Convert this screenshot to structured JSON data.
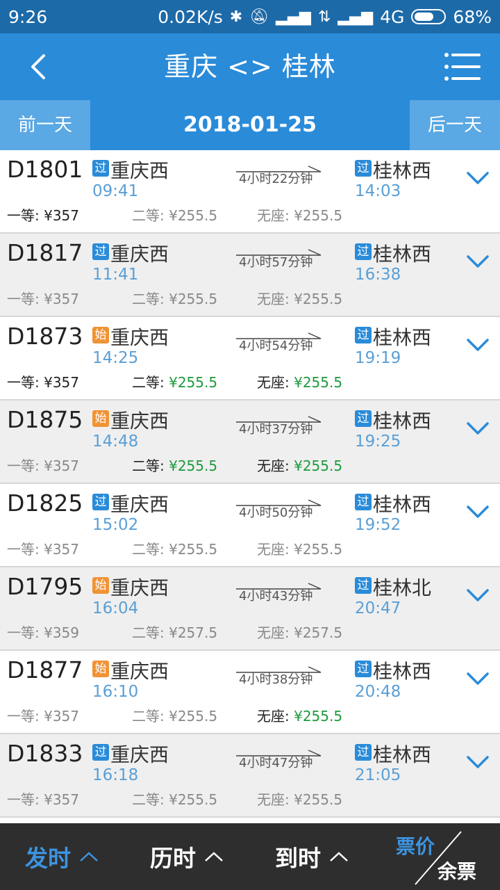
{
  "statusbar": {
    "time": "9:26",
    "speed": "0.02K/s",
    "network": "4G",
    "battery": "68%",
    "battery_level": 0.68
  },
  "header": {
    "title": "重庆 <> 桂林"
  },
  "datebar": {
    "prev_label": "前一天",
    "date": "2018-01-25",
    "next_label": "后一天"
  },
  "trains": [
    {
      "no": "D1801",
      "dep_badge": "过",
      "dep_badge_type": "pass",
      "dep_station": "重庆西",
      "dep_time": "09:41",
      "duration": "4小时22分钟",
      "arr_badge": "过",
      "arr_badge_type": "pass",
      "arr_station": "桂林西",
      "arr_time": "14:03",
      "first_label": "一等:",
      "first_price": "¥357",
      "first_avail": true,
      "second_label": "二等:",
      "second_price": "¥255.5",
      "second_avail": false,
      "noseat_label": "无座:",
      "noseat_price": "¥255.5",
      "noseat_avail": false
    },
    {
      "no": "D1817",
      "dep_badge": "过",
      "dep_badge_type": "pass",
      "dep_station": "重庆西",
      "dep_time": "11:41",
      "duration": "4小时57分钟",
      "arr_badge": "过",
      "arr_badge_type": "pass",
      "arr_station": "桂林西",
      "arr_time": "16:38",
      "first_label": "一等:",
      "first_price": "¥357",
      "first_avail": false,
      "second_label": "二等:",
      "second_price": "¥255.5",
      "second_avail": false,
      "noseat_label": "无座:",
      "noseat_price": "¥255.5",
      "noseat_avail": false
    },
    {
      "no": "D1873",
      "dep_badge": "始",
      "dep_badge_type": "start",
      "dep_station": "重庆西",
      "dep_time": "14:25",
      "duration": "4小时54分钟",
      "arr_badge": "过",
      "arr_badge_type": "pass",
      "arr_station": "桂林西",
      "arr_time": "19:19",
      "first_label": "一等:",
      "first_price": "¥357",
      "first_avail": true,
      "second_label": "二等:",
      "second_price": "¥255.5",
      "second_avail": true,
      "second_green": true,
      "noseat_label": "无座:",
      "noseat_price": "¥255.5",
      "noseat_avail": true,
      "noseat_green": true
    },
    {
      "no": "D1875",
      "dep_badge": "始",
      "dep_badge_type": "start",
      "dep_station": "重庆西",
      "dep_time": "14:48",
      "duration": "4小时37分钟",
      "arr_badge": "过",
      "arr_badge_type": "pass",
      "arr_station": "桂林西",
      "arr_time": "19:25",
      "first_label": "一等:",
      "first_price": "¥357",
      "first_avail": false,
      "second_label": "二等:",
      "second_price": "¥255.5",
      "second_avail": true,
      "second_green": true,
      "noseat_label": "无座:",
      "noseat_price": "¥255.5",
      "noseat_avail": true,
      "noseat_green": true
    },
    {
      "no": "D1825",
      "dep_badge": "过",
      "dep_badge_type": "pass",
      "dep_station": "重庆西",
      "dep_time": "15:02",
      "duration": "4小时50分钟",
      "arr_badge": "过",
      "arr_badge_type": "pass",
      "arr_station": "桂林西",
      "arr_time": "19:52",
      "first_label": "一等:",
      "first_price": "¥357",
      "first_avail": false,
      "second_label": "二等:",
      "second_price": "¥255.5",
      "second_avail": false,
      "noseat_label": "无座:",
      "noseat_price": "¥255.5",
      "noseat_avail": false
    },
    {
      "no": "D1795",
      "dep_badge": "始",
      "dep_badge_type": "start",
      "dep_station": "重庆西",
      "dep_time": "16:04",
      "duration": "4小时43分钟",
      "arr_badge": "过",
      "arr_badge_type": "pass",
      "arr_station": "桂林北",
      "arr_time": "20:47",
      "first_label": "一等:",
      "first_price": "¥359",
      "first_avail": false,
      "second_label": "二等:",
      "second_price": "¥257.5",
      "second_avail": false,
      "noseat_label": "无座:",
      "noseat_price": "¥257.5",
      "noseat_avail": false
    },
    {
      "no": "D1877",
      "dep_badge": "始",
      "dep_badge_type": "start",
      "dep_station": "重庆西",
      "dep_time": "16:10",
      "duration": "4小时38分钟",
      "arr_badge": "过",
      "arr_badge_type": "pass",
      "arr_station": "桂林西",
      "arr_time": "20:48",
      "first_label": "一等:",
      "first_price": "¥357",
      "first_avail": false,
      "second_label": "二等:",
      "second_price": "¥255.5",
      "second_avail": false,
      "noseat_label": "无座:",
      "noseat_price": "¥255.5",
      "noseat_avail": true,
      "noseat_green": true
    },
    {
      "no": "D1833",
      "dep_badge": "过",
      "dep_badge_type": "pass",
      "dep_station": "重庆西",
      "dep_time": "16:18",
      "duration": "4小时47分钟",
      "arr_badge": "过",
      "arr_badge_type": "pass",
      "arr_station": "桂林西",
      "arr_time": "21:05",
      "first_label": "一等:",
      "first_price": "¥357",
      "first_avail": false,
      "second_label": "二等:",
      "second_price": "¥255.5",
      "second_avail": false,
      "noseat_label": "无座:",
      "noseat_price": "¥255.5",
      "noseat_avail": false
    }
  ],
  "bottombar": {
    "sort_dep": "发时",
    "sort_duration": "历时",
    "sort_arr": "到时",
    "sort_price": "票价",
    "sort_remaining": "余票"
  },
  "colors": {
    "header_blue": "#2a8bd9",
    "status_blue": "#1d6aa8",
    "time_blue": "#5a9fd6",
    "badge_pass": "#2a8bd9",
    "badge_start": "#f19335",
    "available_green": "#1c9a3b",
    "bottom_bg": "#2e2e2e",
    "sort_active": "#3d94e0"
  }
}
